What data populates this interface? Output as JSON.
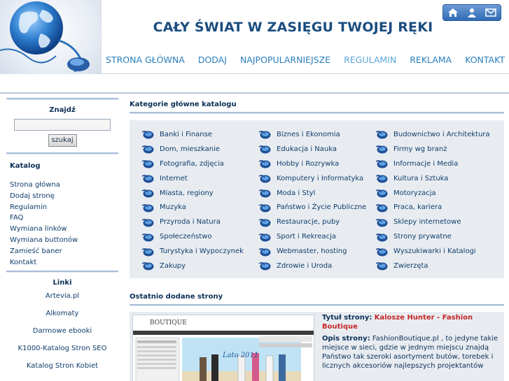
{
  "header": {
    "title": "CAŁY ŚWIAT W ZASIĘGU TWOJEJ RĘKI",
    "top_icons": [
      "home-icon",
      "user-icon",
      "mail-icon"
    ],
    "nav": [
      {
        "label": "STRONA GŁÓWNA"
      },
      {
        "label": "DODAJ"
      },
      {
        "label": "NAJPOPULARNIEJSZE"
      },
      {
        "label": "REGULAMIN"
      },
      {
        "label": "REKLAMA"
      },
      {
        "label": "KONTAKT"
      }
    ]
  },
  "sidebar": {
    "search_title": "Znajdź",
    "search_button": "szukaj",
    "catalog_title": "Katalog",
    "catalog_items": [
      "Strona główna",
      "Dodaj stronę",
      "Regulamin",
      "FAQ",
      "Wymiana linków",
      "Wymiana buttonów",
      "Zamieść baner",
      "Kontakt"
    ],
    "links_title": "Linki",
    "links": [
      "Artevia.pl",
      "Alkomaty",
      "Darmowe ebooki",
      "K1000-Katalog Stron SEO",
      "Katalog Stron Kobiet"
    ]
  },
  "main": {
    "categories_title": "Kategorie główne katalogu",
    "categories": [
      "Banki i Finanse",
      "Biznes i Ekonomia",
      "Budownictwo i Architektura",
      "Dom, mieszkanie",
      "Edukacja i Nauka",
      "Firmy wg branż",
      "Fotografia, zdjęcia",
      "Hobby i Rozrywka",
      "Informacje i Media",
      "Internet",
      "Komputery i Informatyka",
      "Kultura i Sztuka",
      "Miasta, regiony",
      "Moda i Styl",
      "Motoryzacja",
      "Muzyka",
      "Państwo i Życie Publiczne",
      "Praca, kariera",
      "Przyroda i Natura",
      "Restauracje, puby",
      "Sklepy internetowe",
      "Społeczeństwo",
      "Sport i Rekreacja",
      "Strony prywatne",
      "Turystyka i Wypoczynek",
      "Webmaster, hosting",
      "Wyszukiwarki i Katalogi",
      "Zakupy",
      "Zdrowie i Uroda",
      "Zwierzęta"
    ],
    "recent_title": "Ostatnio dodane strony",
    "recent": {
      "title_label": "Tytuł strony:",
      "title_value": "Kalosze Hunter - Fashion Boutique",
      "desc_label": "Opis strony:",
      "desc_value": "FashionBoutique.pl , to jedyne takie miejsce w sieci, gdzie w jednym miejscu znajdą Państwo tak szeroki asortyment butów, torebek i licznych akcesoriów najlepszych projektantów",
      "thumb_brand": "BOUTIQUE",
      "thumb_banner": "Lato 2011"
    }
  },
  "colors": {
    "nav_link": "#2a7fbd",
    "title": "#1b4d80",
    "box_bg": "#e8ecf1",
    "rule": "#a7bddb",
    "highlight": "#c62828"
  }
}
